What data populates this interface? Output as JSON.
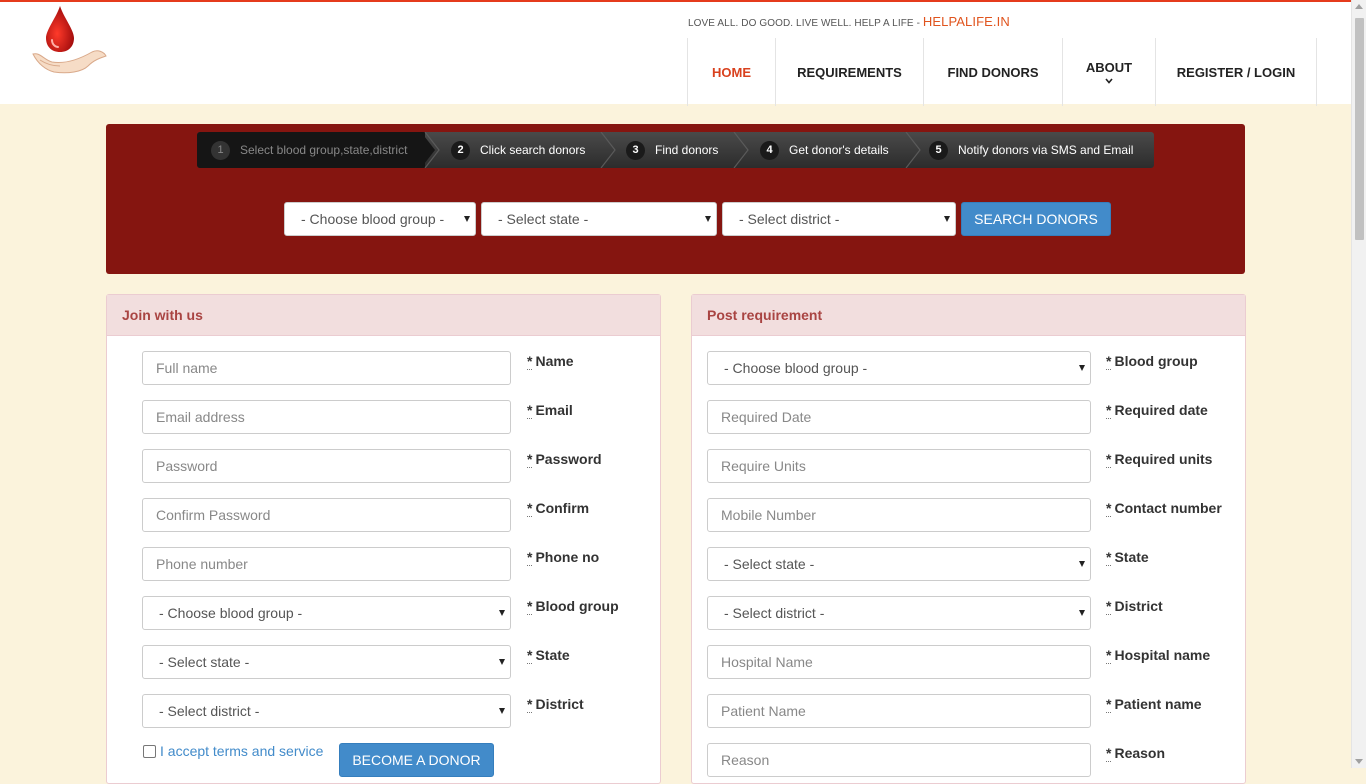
{
  "header": {
    "tagline": "LOVE ALL. DO GOOD. LIVE WELL. HELP A LIFE",
    "tagline_sep": " - ",
    "site_name": "HELPALIFE.IN",
    "nav": [
      {
        "label": "HOME",
        "active": true
      },
      {
        "label": "REQUIREMENTS"
      },
      {
        "label": "FIND DONORS"
      },
      {
        "label": "ABOUT"
      },
      {
        "label": "REGISTER / LOGIN"
      }
    ]
  },
  "search": {
    "steps": [
      {
        "num": "1",
        "label": "Select blood group,state,district"
      },
      {
        "num": "2",
        "label": "Click search donors"
      },
      {
        "num": "3",
        "label": "Find donors"
      },
      {
        "num": "4",
        "label": "Get donor's details"
      },
      {
        "num": "5",
        "label": "Notify donors via SMS and Email"
      }
    ],
    "blood_group": "- Choose blood group -",
    "state": "- Select state -",
    "district": "- Select district -",
    "button": "SEARCH DONORS"
  },
  "join": {
    "title": "Join with us",
    "fields": [
      {
        "placeholder": "Full name",
        "label": "Name"
      },
      {
        "placeholder": "Email address",
        "label": "Email"
      },
      {
        "placeholder": "Password",
        "label": "Password"
      },
      {
        "placeholder": "Confirm Password",
        "label": "Confirm"
      },
      {
        "placeholder": "Phone number",
        "label": "Phone no"
      },
      {
        "value": "- Choose blood group -",
        "label": "Blood group"
      },
      {
        "value": "- Select state -",
        "label": "State"
      },
      {
        "value": "- Select district -",
        "label": "District"
      }
    ],
    "terms": "I accept terms and service",
    "button": "BECOME A DONOR"
  },
  "post": {
    "title": "Post requirement",
    "fields": [
      {
        "value": "- Choose blood group -",
        "label": "Blood group"
      },
      {
        "placeholder": "Required Date",
        "label": "Required date"
      },
      {
        "placeholder": "Require Units",
        "label": "Required units"
      },
      {
        "placeholder": "Mobile Number",
        "label": "Contact number"
      },
      {
        "value": "- Select state -",
        "label": "State"
      },
      {
        "value": "- Select district -",
        "label": "District"
      },
      {
        "placeholder": "Hospital Name",
        "label": "Hospital name"
      },
      {
        "placeholder": "Patient Name",
        "label": "Patient name"
      },
      {
        "placeholder": "Reason",
        "label": "Reason"
      }
    ]
  },
  "required_mark": "*",
  "colors": {
    "accent": "#e53b1c",
    "hero": "#851510",
    "button": "#428bca",
    "page_bg": "#fbf3dc",
    "panel_head": "#f2dede"
  }
}
